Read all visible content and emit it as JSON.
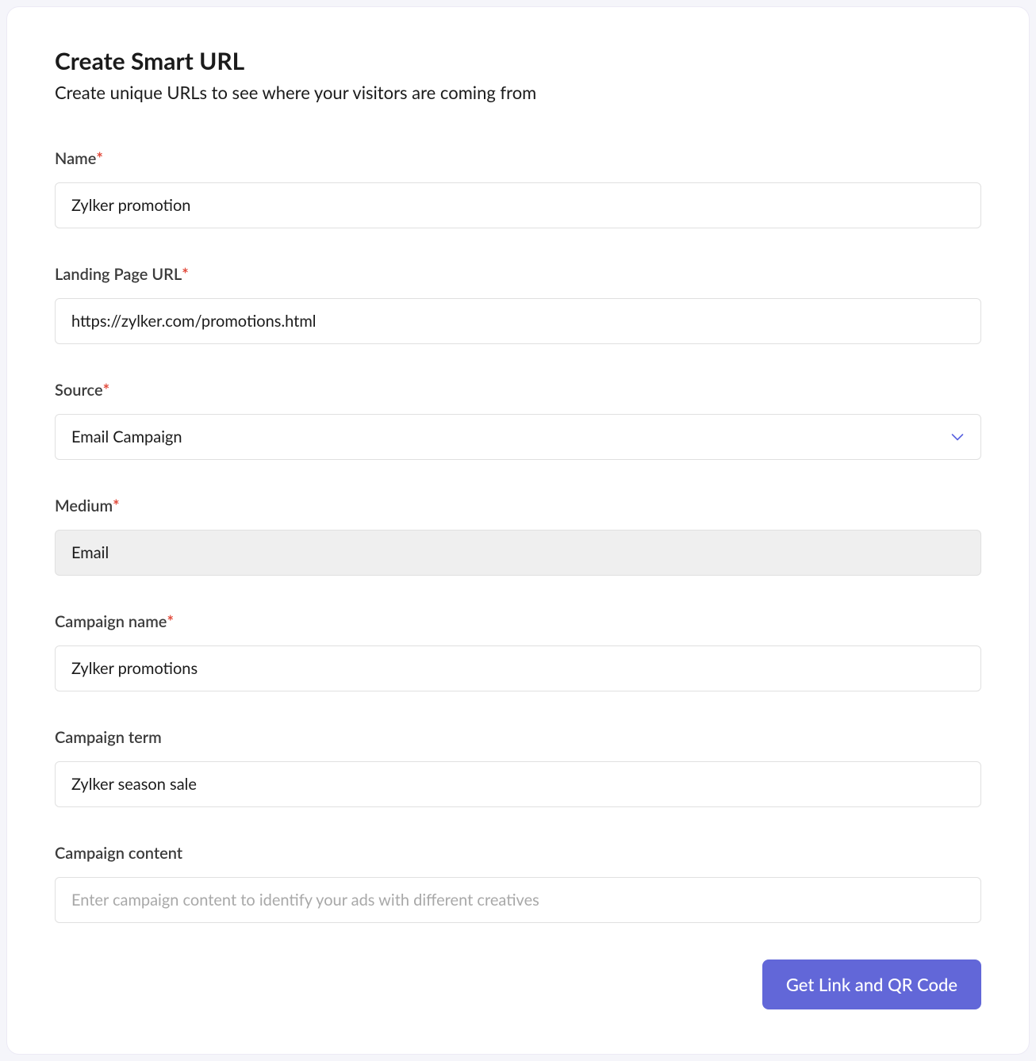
{
  "header": {
    "title": "Create Smart URL",
    "subtitle": "Create unique URLs to see where your visitors are coming from"
  },
  "form": {
    "name": {
      "label": "Name",
      "required_marker": "*",
      "value": "Zylker promotion"
    },
    "landing_page_url": {
      "label": "Landing Page URL",
      "required_marker": "*",
      "value": "https://zylker.com/promotions.html"
    },
    "source": {
      "label": "Source",
      "required_marker": "*",
      "value": "Email Campaign"
    },
    "medium": {
      "label": "Medium",
      "required_marker": "*",
      "value": "Email"
    },
    "campaign_name": {
      "label": "Campaign name",
      "required_marker": "*",
      "value": "Zylker promotions"
    },
    "campaign_term": {
      "label": "Campaign term",
      "value": "Zylker season sale"
    },
    "campaign_content": {
      "label": "Campaign content",
      "value": "",
      "placeholder": "Enter campaign content to identify your ads with different creatives"
    }
  },
  "actions": {
    "submit_label": "Get Link and QR Code"
  }
}
